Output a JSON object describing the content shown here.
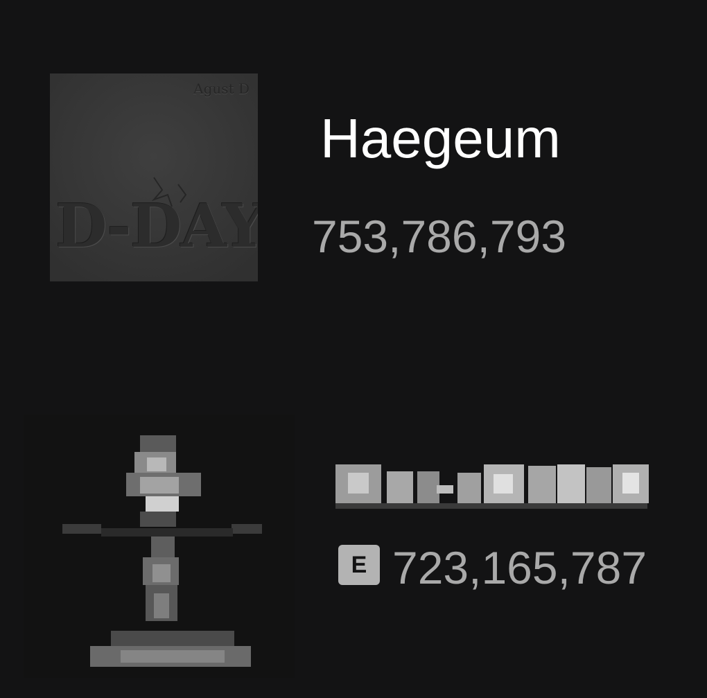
{
  "tracks": [
    {
      "title": "Haegeum",
      "plays": "753,786,793",
      "explicit": false,
      "cover": {
        "artist": "Agust D",
        "title": "D-DAY",
        "icon": "album-cover"
      }
    },
    {
      "title": "",
      "title_obscured": true,
      "plays": "723,165,787",
      "explicit": true,
      "explicit_label": "E",
      "cover": {
        "icon": "album-cover-pixelated"
      }
    }
  ],
  "colors": {
    "background": "#131314",
    "title": "#ffffff",
    "plays": "#a9a9a9",
    "badge": "#b3b3b3"
  }
}
